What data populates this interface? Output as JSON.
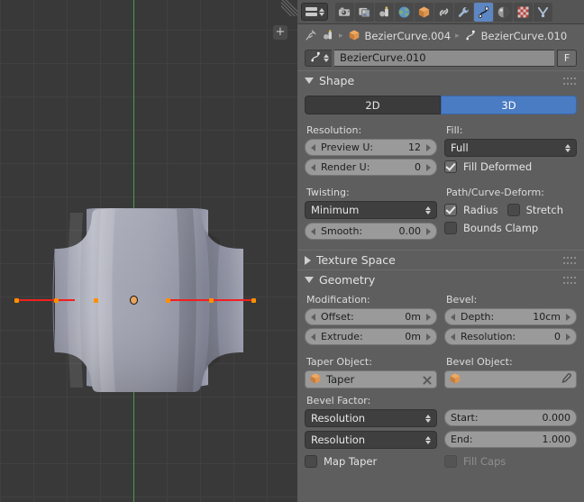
{
  "viewport": {
    "name": "3d-viewport",
    "background_color": "#393939",
    "grid_color": "#414141",
    "axis_y_color": "#4c9a4c",
    "handle_color": "#f02020",
    "control_point_color": "#ff9000",
    "origin_color": "#e8a55c",
    "toolbar_toggle_label": "+"
  },
  "properties": {
    "editor_type_icon": "properties-editor-icon",
    "tabs": [
      {
        "id": "render",
        "icon": "camera-icon",
        "active": false
      },
      {
        "id": "render-layers",
        "icon": "images-icon",
        "active": false
      },
      {
        "id": "scene",
        "icon": "scene-icon",
        "active": false
      },
      {
        "id": "world",
        "icon": "globe-icon",
        "active": false
      },
      {
        "id": "object",
        "icon": "cube-icon",
        "active": false
      },
      {
        "id": "constraints",
        "icon": "chain-icon",
        "active": false
      },
      {
        "id": "modifiers",
        "icon": "wrench-icon",
        "active": false
      },
      {
        "id": "curve-data",
        "icon": "curve-icon",
        "active": true
      },
      {
        "id": "material",
        "icon": "material-icon",
        "active": false
      },
      {
        "id": "texture",
        "icon": "checker-icon",
        "active": false
      },
      {
        "id": "particles",
        "icon": "particles-icon",
        "active": false
      }
    ],
    "breadcrumb": {
      "pin_icon": "pin-icon",
      "root_icon": "scene-icon",
      "object_icon": "cube-icon",
      "object_name": "BezierCurve.004",
      "data_icon": "curve-icon",
      "data_name": "BezierCurve.010",
      "separator": "▸"
    },
    "name_field": {
      "icon": "curve-icon",
      "value": "BezierCurve.010",
      "fake_user_label": "F"
    },
    "panels": {
      "shape": {
        "title": "Shape",
        "open": true,
        "dimension_toggle": {
          "options": [
            "2D",
            "3D"
          ],
          "selected": "3D"
        },
        "resolution_label": "Resolution:",
        "preview_u": {
          "label": "Preview U:",
          "value": "12"
        },
        "render_u": {
          "label": "Render U:",
          "value": "0"
        },
        "fill_label": "Fill:",
        "fill_mode": "Full",
        "fill_deformed": {
          "label": "Fill Deformed",
          "checked": true
        },
        "twisting_label": "Twisting:",
        "twist_method": "Minimum",
        "smooth": {
          "label": "Smooth:",
          "value": "0.00"
        },
        "path_deform_label": "Path/Curve-Deform:",
        "radius": {
          "label": "Radius",
          "checked": true
        },
        "stretch": {
          "label": "Stretch",
          "checked": false
        },
        "bounds_clamp": {
          "label": "Bounds Clamp",
          "checked": false
        }
      },
      "texture_space": {
        "title": "Texture Space",
        "open": false
      },
      "geometry": {
        "title": "Geometry",
        "open": true,
        "modification_label": "Modification:",
        "offset": {
          "label": "Offset:",
          "value": "0m"
        },
        "extrude": {
          "label": "Extrude:",
          "value": "0m"
        },
        "bevel_label": "Bevel:",
        "depth": {
          "label": "Depth:",
          "value": "10cm"
        },
        "bevel_resolution": {
          "label": "Resolution:",
          "value": "0"
        },
        "taper_object": {
          "label": "Taper Object:",
          "value": "Taper",
          "icon": "cube-icon",
          "clear_icon": "x-icon"
        },
        "bevel_object": {
          "label": "Bevel Object:",
          "value": "",
          "icon": "cube-icon",
          "pick_icon": "eyedropper-icon"
        },
        "bevel_factor_label": "Bevel Factor:",
        "start_mapping": "Resolution",
        "end_mapping": "Resolution",
        "start": {
          "label": "Start:",
          "value": "0.000"
        },
        "end": {
          "label": "End:",
          "value": "1.000"
        },
        "map_taper": {
          "label": "Map Taper",
          "checked": false,
          "disabled": false
        },
        "fill_caps": {
          "label": "Fill Caps",
          "checked": false,
          "disabled": true
        }
      }
    }
  }
}
